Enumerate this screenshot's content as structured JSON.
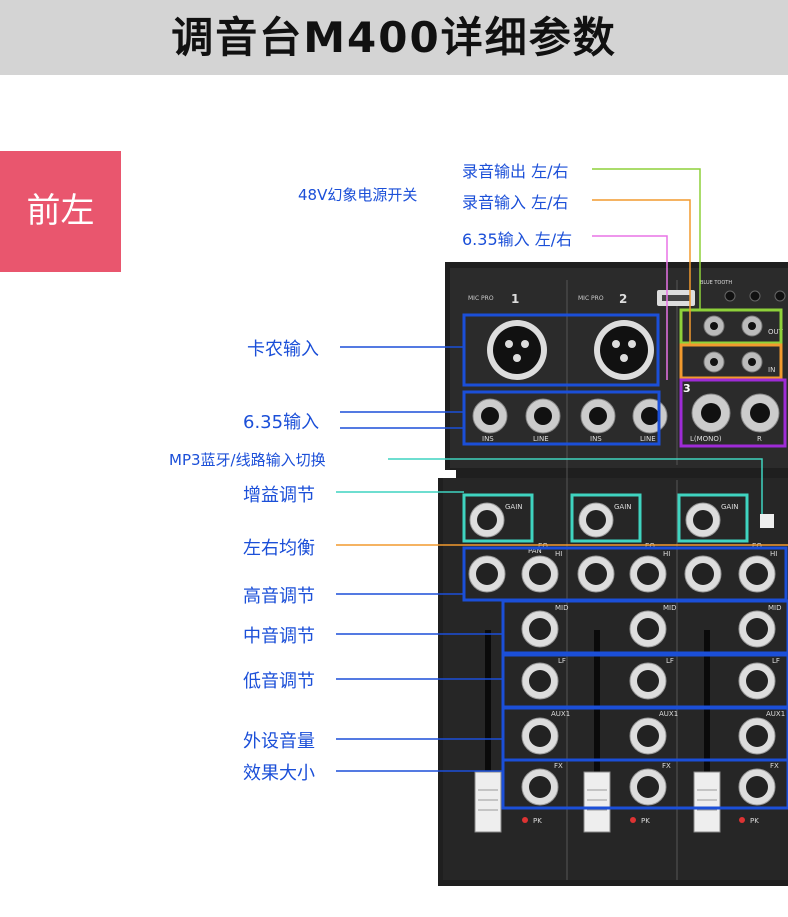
{
  "page": {
    "title": "调音台M400详细参数",
    "side_tag": "前左"
  },
  "colors": {
    "blue": "#1b4fd8",
    "green": "#8ed13a",
    "orange": "#f29a2e",
    "pink": "#e873e6",
    "teal": "#3fd4c0",
    "purple": "#9e2bd6",
    "tag": "#e9566e"
  },
  "labels": {
    "rec_out": "录音输出 左/右",
    "rec_in": "录音输入 左/右",
    "jack_in_lr": "6.35输入 左/右",
    "phantom": "48V幻象电源开关",
    "xlr_in": "卡农输入",
    "jack_in": "6.35输入",
    "mp3_switch": "MP3蓝牙/线路输入切换",
    "gain": "增益调节",
    "pan": "左右均衡",
    "high": "高音调节",
    "mid": "中音调节",
    "low": "低音调节",
    "aux": "外设音量",
    "fx": "效果大小"
  },
  "device": {
    "ch1": "1",
    "ch2": "2",
    "ch3": "3",
    "mic_pro": "MIC PRO",
    "bluetooth": "BLUE TOOTH",
    "ins": "INS",
    "line": "LINE",
    "l_mono": "L(MONO)",
    "r": "R",
    "gain": "GAIN",
    "pan": "PAN",
    "eq": "EQ",
    "hi": "HI",
    "mid": "MID",
    "lf": "LF",
    "aux1": "AUX1",
    "fx": "FX",
    "pk": "PK",
    "out": "OUT",
    "in": "IN"
  }
}
